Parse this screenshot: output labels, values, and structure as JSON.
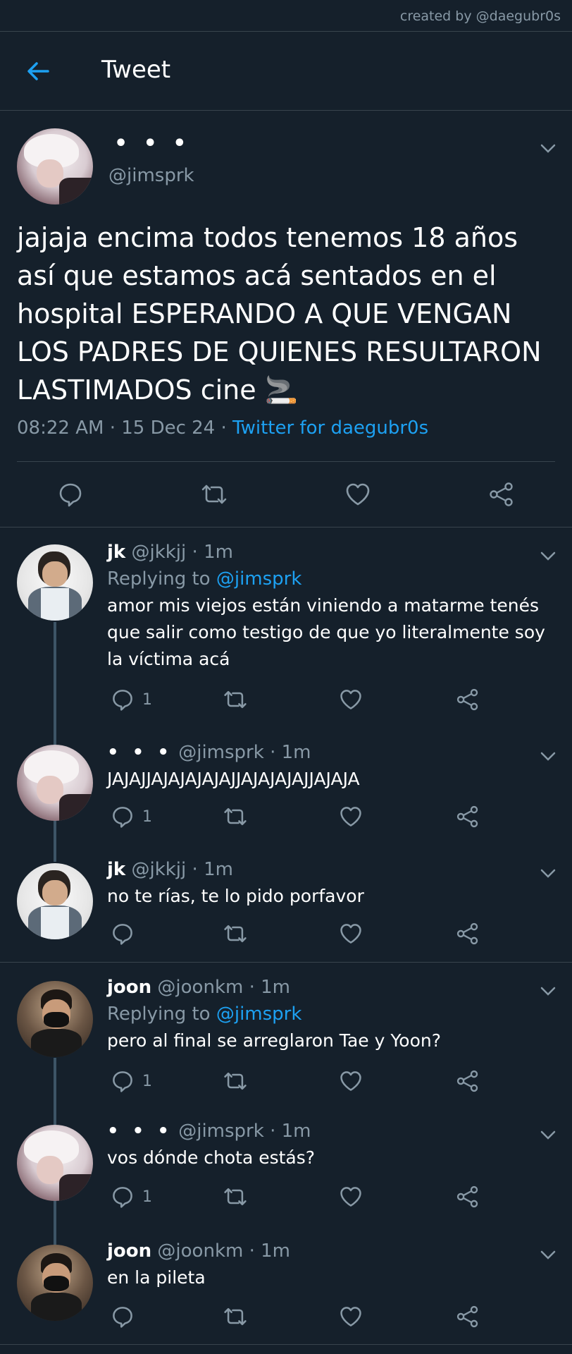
{
  "credit": "created by @daegubr0s",
  "header": {
    "title": "Tweet"
  },
  "main_tweet": {
    "name": "• • •",
    "handle": "@jimsprk",
    "text": "jajaja encima todos tenemos 18 años así que estamos acá sentados en el hospital ESPERANDO A QUE VENGAN LOS PADRES DE QUIENES RESULTARON LASTIMADOS cine 🚬",
    "time": "08:22 AM",
    "dot": "·",
    "date": "15 Dec 24",
    "source": "Twitter for daegubr0s"
  },
  "replies": [
    {
      "name": "jk",
      "handle": "@jkkjj",
      "sep": "·",
      "time": "1m",
      "replying_label": "Replying to",
      "replying_to": "@jimsprk",
      "text": "amor mis viejos están viniendo a matarme tenés que salir como testigo de que yo literalmente soy la víctima acá",
      "reply_count": "1"
    },
    {
      "name": "• • •",
      "handle": "@jimsprk",
      "sep": "·",
      "time": "1m",
      "text": "JAJAJJAJAJAJAJAJJAJAJAJAJJAJAJA",
      "reply_count": "1"
    },
    {
      "name": "jk",
      "handle": "@jkkjj",
      "sep": "·",
      "time": "1m",
      "text": "no te rías, te lo pido porfavor"
    },
    {
      "name": "joon",
      "handle": "@joonkm",
      "sep": "·",
      "time": "1m",
      "replying_label": "Replying to",
      "replying_to": "@jimsprk",
      "text": "pero al final se arreglaron Tae y Yoon?",
      "reply_count": "1"
    },
    {
      "name": "• • •",
      "handle": "@jimsprk",
      "sep": "·",
      "time": "1m",
      "text": "vos dónde chota estás?",
      "reply_count": "1"
    },
    {
      "name": "joon",
      "handle": "@joonkm",
      "sep": "·",
      "time": "1m",
      "text": "en la pileta"
    }
  ],
  "icons": [
    "back-arrow-icon",
    "chevron-down-icon",
    "reply-icon",
    "retweet-icon",
    "like-icon",
    "share-icon"
  ],
  "colors": {
    "background": "#15202b",
    "accent": "#1da1f2",
    "muted": "#8899a6",
    "divider": "#38444d"
  }
}
